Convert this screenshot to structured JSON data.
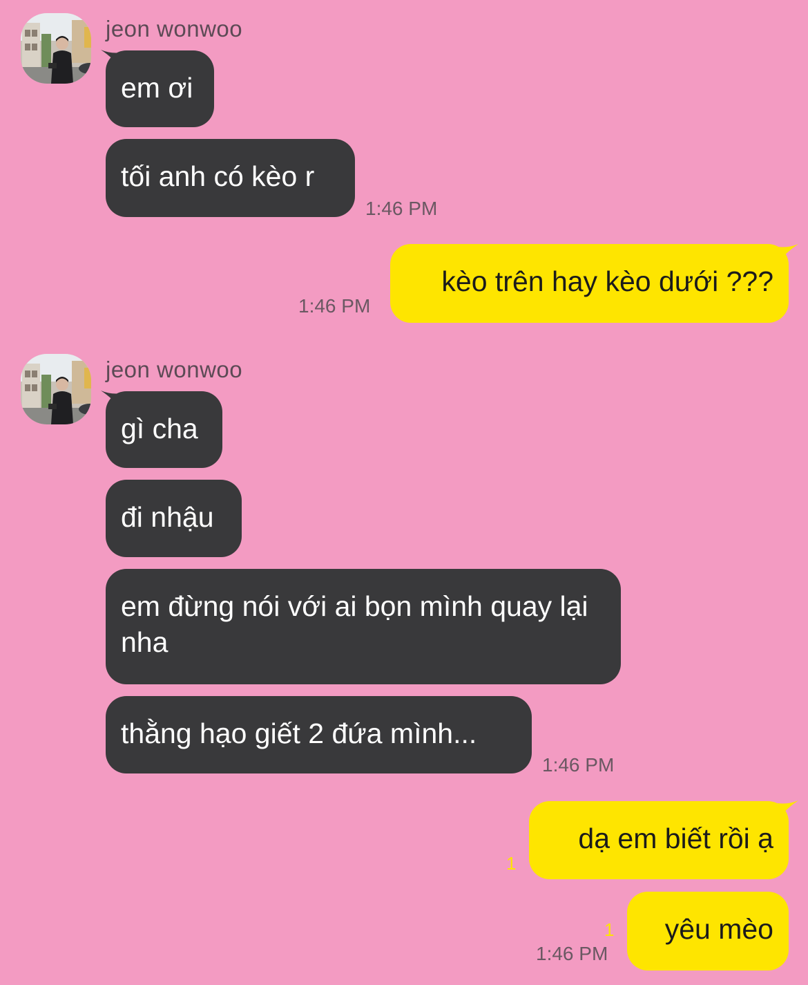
{
  "theme": {
    "background": "#f39bc2",
    "incoming_bubble": "#39393b",
    "outgoing_bubble": "#fee500",
    "unread_color": "#fee500"
  },
  "messages": {
    "group1": {
      "sender": "jeon wonwoo",
      "avatar_icon": "profile-photo-icon",
      "bubbles": [
        "em ơi",
        "tối anh có kèo r"
      ],
      "time": "1:46 PM"
    },
    "reply1": {
      "text": "kèo trên hay kèo dưới ???",
      "time": "1:46 PM"
    },
    "group2": {
      "sender": "jeon wonwoo",
      "avatar_icon": "profile-photo-icon",
      "bubbles": [
        "gì cha",
        "đi nhậu",
        "em đừng nói với ai bọn mình quay lại nha",
        "thằng hạo giết 2 đứa mình..."
      ],
      "time": "1:46 PM"
    },
    "reply2": {
      "bubbles": [
        "dạ em biết rồi ạ",
        "yêu mèo"
      ],
      "unread": [
        "1",
        "1"
      ],
      "time": "1:46 PM"
    }
  }
}
